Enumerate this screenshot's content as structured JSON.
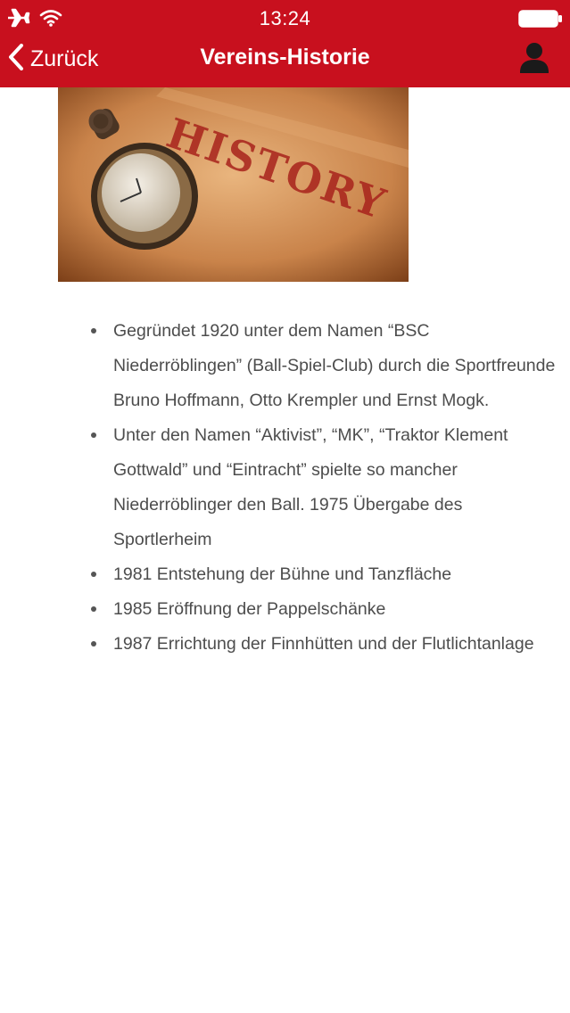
{
  "status_bar": {
    "time": "13:24",
    "icons": [
      "airplane-icon",
      "wifi-icon",
      "battery-icon"
    ]
  },
  "nav": {
    "back_label": "Zurück",
    "title": "Vereins-Historie",
    "profile_icon": "profile-icon"
  },
  "hero": {
    "stamp_text": "HISTORY",
    "image_subject": "pocket-watch"
  },
  "history": [
    "Gegründet 1920 unter dem Namen “BSC Niederröblingen” (Ball-Spiel-Club) durch die Sportfreunde Bruno Hoffmann, Otto Krempler und Ernst Mogk.",
    "Unter den Namen “Aktivist”, “MK”, “Traktor Klement Gottwald” und “Eintracht” spielte so mancher Niederröblinger den Ball. 1975 Übergabe des Sportlerheim",
    "1981 Entstehung der Bühne und Tanzfläche",
    "1985 Eröffnung der Pappelschänke",
    "1987 Errichtung der Finnhütten und der Flutlichtanlage"
  ],
  "colors": {
    "brand_red": "#c8101e",
    "text": "#4d4d4d",
    "background": "#ffffff"
  }
}
